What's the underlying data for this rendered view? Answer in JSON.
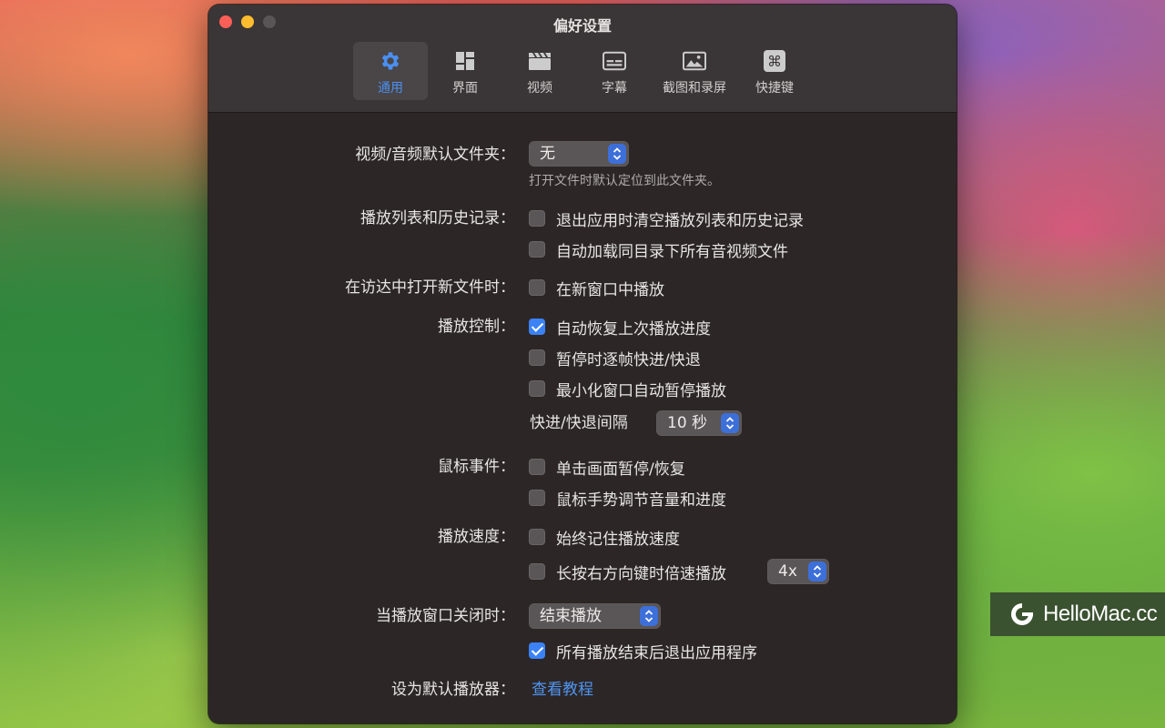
{
  "window": {
    "title": "偏好设置"
  },
  "tabs": [
    {
      "label": "通用",
      "icon": "gear-icon",
      "selected": true
    },
    {
      "label": "界面",
      "icon": "layout-icon",
      "selected": false
    },
    {
      "label": "视频",
      "icon": "clapperboard-icon",
      "selected": false
    },
    {
      "label": "字幕",
      "icon": "subtitles-icon",
      "selected": false
    },
    {
      "label": "截图和录屏",
      "icon": "image-icon",
      "selected": false
    },
    {
      "label": "快捷键",
      "icon": "command-key-icon",
      "selected": false
    }
  ],
  "default_folder": {
    "label": "视频/音频默认文件夹：",
    "value": "无",
    "hint": "打开文件时默认定位到此文件夹。"
  },
  "playlist_history": {
    "label": "播放列表和历史记录：",
    "options": [
      {
        "text": "退出应用时清空播放列表和历史记录",
        "checked": false
      },
      {
        "text": "自动加载同目录下所有音视频文件",
        "checked": false
      }
    ]
  },
  "finder_open": {
    "label": "在访达中打开新文件时：",
    "options": [
      {
        "text": "在新窗口中播放",
        "checked": false
      }
    ]
  },
  "playback_control": {
    "label": "播放控制：",
    "options": [
      {
        "text": "自动恢复上次播放进度",
        "checked": true
      },
      {
        "text": "暂停时逐帧快进/快退",
        "checked": false
      },
      {
        "text": "最小化窗口自动暂停播放",
        "checked": false
      }
    ],
    "seek_interval_label": "快进/快退间隔",
    "seek_interval_value": "10 秒"
  },
  "mouse_events": {
    "label": "鼠标事件：",
    "options": [
      {
        "text": "单击画面暂停/恢复",
        "checked": false
      },
      {
        "text": "鼠标手势调节音量和进度",
        "checked": false
      }
    ]
  },
  "playback_speed": {
    "label": "播放速度：",
    "options": [
      {
        "text": "始终记住播放速度",
        "checked": false
      },
      {
        "text": "长按右方向键时倍速播放",
        "checked": false
      }
    ],
    "hold_speed_value": "4x"
  },
  "window_close": {
    "label": "当播放窗口关闭时：",
    "value": "结束播放",
    "options": [
      {
        "text": "所有播放结束后退出应用程序",
        "checked": true
      }
    ]
  },
  "default_player": {
    "label": "设为默认播放器：",
    "link": "查看教程"
  },
  "watermark": {
    "text": "HelloMac.cc"
  },
  "colors": {
    "accent": "#3b82f6",
    "window_bg": "#2c2627",
    "toolbar_bg": "#3a3536"
  }
}
